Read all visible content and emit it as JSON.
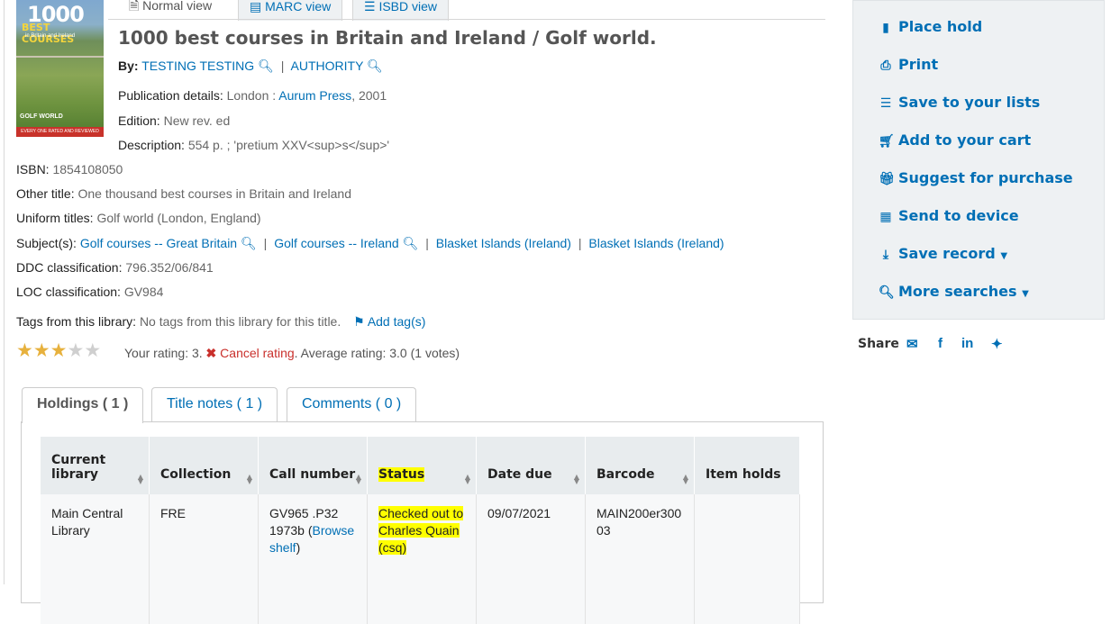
{
  "views": {
    "normal": "Normal view",
    "marc": "MARC view",
    "isbd": "ISBD view"
  },
  "record": {
    "title": "1000 best courses in Britain and Ireland / Golf world.",
    "by_label": "By:",
    "authors": [
      "TESTING TESTING",
      "AUTHORITY"
    ],
    "pub_label": "Publication details:",
    "pub_place": "London :",
    "publisher": "Aurum Press",
    "pub_year": ", 2001",
    "edition_label": "Edition:",
    "edition": "New rev. ed",
    "description_label": "Description:",
    "description": "554 p. ; 'pretium XXV<sup>s</sup>'",
    "isbn_label": "ISBN:",
    "isbn": "1854108050",
    "other_title_label": "Other title:",
    "other_title": "One thousand best courses in Britain and Ireland",
    "uniform_label": "Uniform titles:",
    "uniform": "Golf world (London, England)",
    "subjects_label": "Subject(s):",
    "subjects": [
      "Golf courses -- Great Britain",
      "Golf courses -- Ireland",
      "Blasket Islands (Ireland)",
      "Blasket Islands (Ireland)"
    ],
    "ddc_label": "DDC classification:",
    "ddc": "796.352/06/841",
    "loc_label": "LOC classification:",
    "loc": "GV984",
    "tags_label": "Tags from this library:",
    "tags_value": "No tags from this library for this title.",
    "add_tags": "Add tag(s)"
  },
  "cover": {
    "num": "1000",
    "best": "BEST COURSES",
    "sub": "in Britain and Ireland",
    "golf": "GOLF WORLD",
    "strip": "EVERY ONE RATED AND REVIEWED"
  },
  "rating": {
    "stars_total": 5,
    "stars_filled": 3,
    "your_rating": "Your rating: 3.",
    "cancel": "Cancel rating",
    "average": ". Average rating: 3.0 (1 votes)"
  },
  "tabs": {
    "holdings": "Holdings ( 1 )",
    "title_notes": "Title notes ( 1 )",
    "comments": "Comments ( 0 )"
  },
  "holdings": {
    "headers": [
      "Current library",
      "Collection",
      "Call number",
      "Status",
      "Date due",
      "Barcode",
      "Item holds"
    ],
    "row": {
      "library": "Main Central Library",
      "collection": "FRE",
      "call_number": "GV965 .P32 1973b",
      "browse_open": "(",
      "browse": "Browse shelf",
      "browse_close": ")",
      "status": "Checked out to Charles Quain (csq)",
      "date_due": "09/07/2021",
      "barcode": "MAIN200er30003",
      "item_holds": ""
    }
  },
  "sidebar": {
    "items": [
      {
        "label": "Place hold",
        "icon": "bookmark-icon"
      },
      {
        "label": "Print",
        "icon": "print-icon"
      },
      {
        "label": "Save to your lists",
        "icon": "list-icon"
      },
      {
        "label": "Add to your cart",
        "icon": "cart-icon"
      },
      {
        "label": "Suggest for purchase",
        "icon": "gift-icon"
      },
      {
        "label": "Send to device",
        "icon": "qrcode-icon"
      },
      {
        "label": "Save record",
        "icon": "download-icon"
      },
      {
        "label": "More searches",
        "icon": "search-icon"
      }
    ],
    "share_label": "Share"
  },
  "colors": {
    "link": "#006fb5",
    "highlight": "#ffff00",
    "star": "#e7b13d",
    "cancel": "#c9302c"
  }
}
